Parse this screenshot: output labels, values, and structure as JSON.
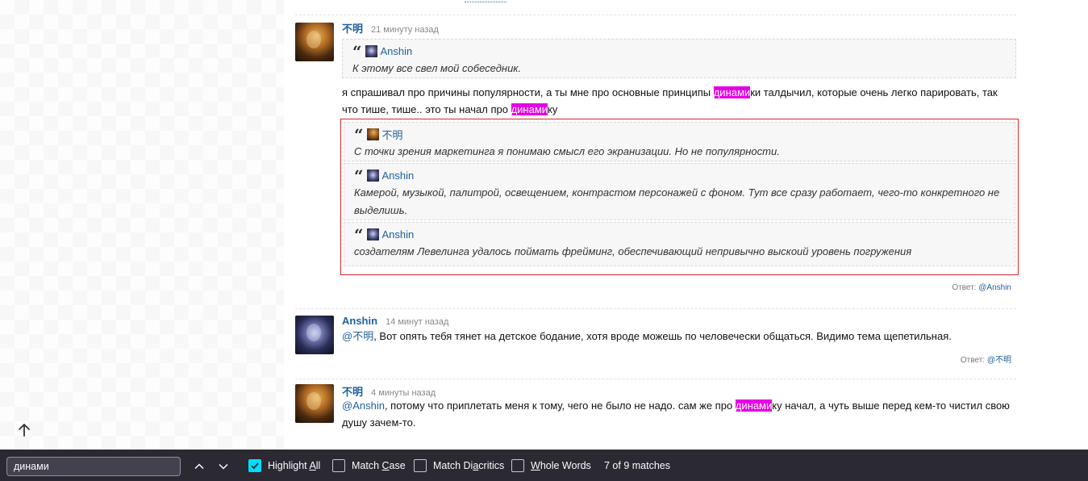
{
  "comments": [
    {
      "author": "不明",
      "time": "21 минуту назад",
      "quote": {
        "author": "Anshin",
        "text": "К этому все свел мой собеседник."
      },
      "body": {
        "p1": "я спрашивал про причины популярности, а ты мне про основные принципы ",
        "hl1": "динами",
        "p2": "ки талдычил, которые очень легко парировать, так что тише, тише.. это ты начал про ",
        "hl2": "динами",
        "p3": "ку"
      },
      "quote_group": [
        {
          "author": "不明",
          "text": "С точки зрения маркетинга я понимаю смысл его экранизации. Но не популярности."
        },
        {
          "author": "Anshin",
          "text": "Камерой, музыкой, палитрой, освещением, контрастом персонажей с фоном. Тут все сразу работает, чего-то конкретного не выделишь."
        },
        {
          "author": "Anshin",
          "text": "создателям Левелинга удалось поймать фрейминг, обеспечивающий непривычно выскоий уровень погружения"
        }
      ],
      "reply_label": "Ответ:",
      "reply_to": "@Anshin"
    },
    {
      "author": "Anshin",
      "time": "14 минут назад",
      "mention": "@不明",
      "text": ", Вот опять тебя тянет на детское бодание, хотя вроде можешь по человечески общаться. Видимо тема щепетильная.",
      "reply_label": "Ответ:",
      "reply_to": "@不明"
    },
    {
      "author": "不明",
      "time": "4 минуты назад",
      "mention": "@Anshin",
      "p1": ", потому что приплетать меня к тому, чего не было не надо. сам же про ",
      "hl": "динами",
      "p2": "ку начал, а чуть выше перед кем-то чистил свою душу зачем-то."
    }
  ],
  "findbar": {
    "query": "динами",
    "highlight_all": {
      "pre": "Highlight ",
      "u": "A",
      "post": "ll",
      "checked": true
    },
    "match_case": {
      "pre": "Match ",
      "u": "C",
      "post": "ase",
      "checked": false
    },
    "match_diacritics": {
      "pre": "Match Di",
      "u": "a",
      "post": "critics",
      "checked": false
    },
    "whole_words": {
      "pre": "",
      "u": "W",
      "post": "hole Words",
      "checked": false
    },
    "status": "7 of 9 matches"
  },
  "colors": {
    "highlight": "#e600e6",
    "link": "#1f5f9c",
    "findbar_bg": "#2b2a33",
    "checkbox_on": "#00ddff",
    "quote_group_border": "#d7282f"
  }
}
